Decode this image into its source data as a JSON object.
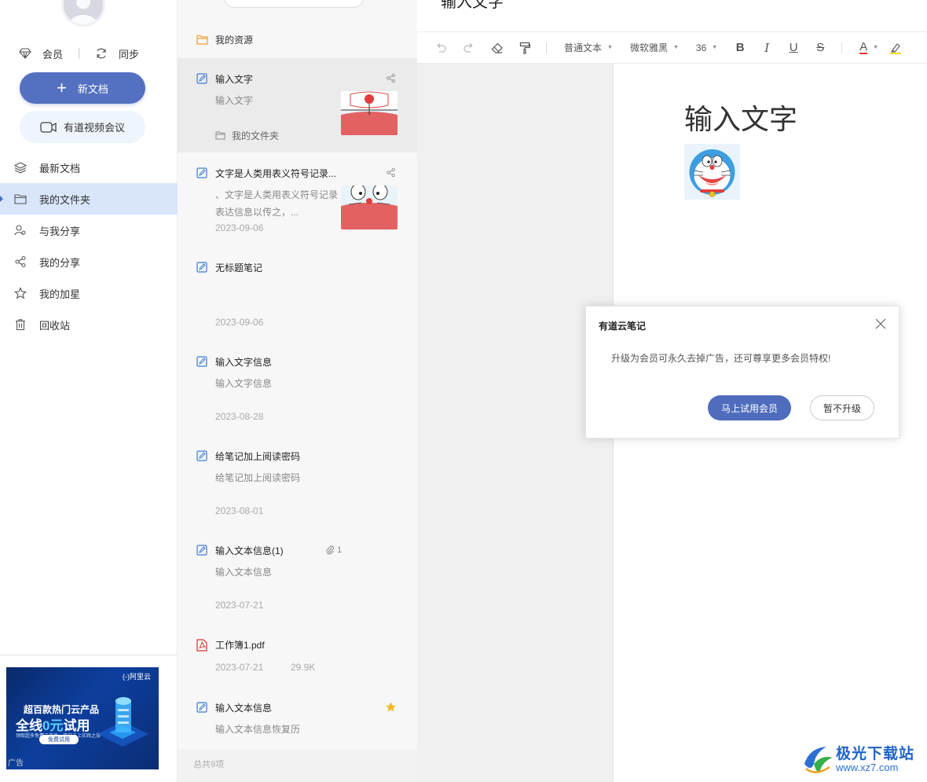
{
  "sidebar": {
    "vip_label": "会员",
    "sync_label": "同步",
    "new_doc_label": "新文档",
    "video_meeting_label": "有道视频会议",
    "nav": [
      {
        "label": "最新文档",
        "icon": "layers-icon",
        "active": false
      },
      {
        "label": "我的文件夹",
        "icon": "folder-icon",
        "active": true
      },
      {
        "label": "与我分享",
        "icon": "users-icon",
        "active": false
      },
      {
        "label": "我的分享",
        "icon": "share-icon",
        "active": false
      },
      {
        "label": "我的加星",
        "icon": "star-icon",
        "active": false
      },
      {
        "label": "回收站",
        "icon": "trash-icon",
        "active": false
      }
    ],
    "ad": {
      "brand": "(-)阿里云",
      "line1": "超百款热门云产品",
      "line2_a": "全线",
      "line2_b": "0元",
      "line2_c": "试用",
      "line3": "领取超多免费云产品，开启云上实践之旅",
      "button": "免费试用",
      "label": "广告"
    }
  },
  "notelist": {
    "resource_label": "我的资源",
    "notes": [
      {
        "title": "输入文字",
        "snippet": "输入文字",
        "folder": "我的文件夹",
        "selected": true,
        "share": true,
        "thumb": "doraemon-bell"
      },
      {
        "title": "文字是人类用表义符号记录...",
        "snippet": "、文字是人类用表义符号记录表达信息以传之，...",
        "date": "2023-09-06",
        "share": true,
        "thumb": "doraemon-face"
      },
      {
        "title": "无标题笔记",
        "snippet": "",
        "date": "2023-09-06"
      },
      {
        "title": "输入文字信息",
        "snippet": "输入文字信息",
        "date": "2023-08-28"
      },
      {
        "title": "给笔记加上阅读密码",
        "snippet": "给笔记加上阅读密码",
        "date": "2023-08-01"
      },
      {
        "title": "输入文本信息(1)",
        "snippet": "输入文本信息",
        "date": "2023-07-21",
        "attachments": "1"
      },
      {
        "title": "工作簿1.pdf",
        "snippet": "",
        "date": "2023-07-21",
        "size": "29.9K",
        "type": "pdf"
      },
      {
        "title": "输入文本信息",
        "snippet": "输入文本信息恢复历",
        "starred": true
      }
    ],
    "footer": "总共9项"
  },
  "editor": {
    "doc_title": "输入文字",
    "toolbar": {
      "paragraph_style": "普通文本",
      "font_family": "微软雅黑",
      "font_size": "36",
      "bold": "B",
      "italic": "I",
      "underline": "U",
      "strike": "S",
      "font_color": "A"
    },
    "heading": "输入文字"
  },
  "dialog": {
    "title": "有道云笔记",
    "message": "升级为会员可永久去掉广告，还可尊享更多会员特权!",
    "primary": "马上试用会员",
    "secondary": "暂不升级"
  },
  "watermark": {
    "name": "极光下载站",
    "url": "www.xz7.com"
  }
}
